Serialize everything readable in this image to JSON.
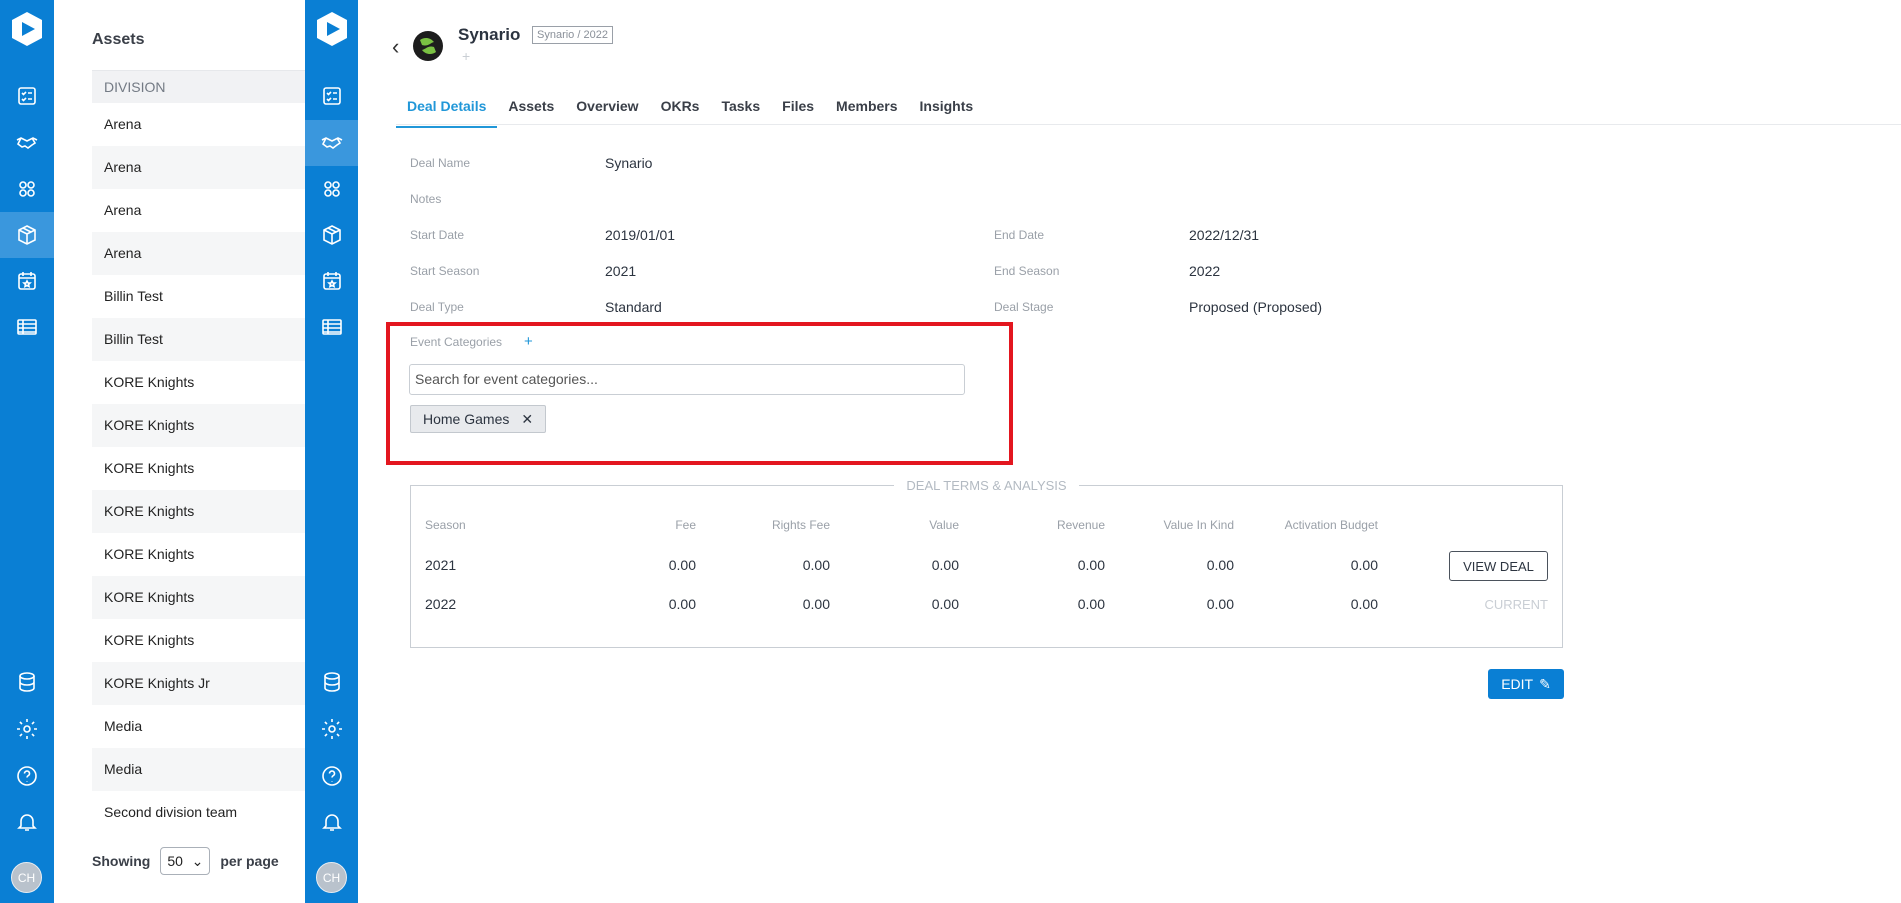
{
  "rail": {
    "avatar_initials": "CH",
    "icons": [
      "checklist-icon",
      "handshake-icon",
      "people-icon",
      "box-icon",
      "calendar-icon",
      "table-icon",
      "database-icon",
      "gear-icon",
      "help-icon",
      "bell-icon"
    ]
  },
  "assets": {
    "title": "Assets",
    "column_header": "DIVISION",
    "rows": [
      "Arena",
      "Arena",
      "Arena",
      "Arena",
      "Billin Test",
      "Billin Test",
      "KORE Knights",
      "KORE Knights",
      "KORE Knights",
      "KORE Knights",
      "KORE Knights",
      "KORE Knights",
      "KORE Knights",
      "KORE Knights Jr",
      "Media",
      "Media",
      "Second division team"
    ],
    "footer_showing": "Showing",
    "per_page_value": "50",
    "footer_per_page": "per page"
  },
  "header": {
    "property_name": "Synario",
    "property_tag": "Synario / 2022",
    "add_symbol": "+"
  },
  "tabs": [
    "Deal Details",
    "Assets",
    "Overview",
    "OKRs",
    "Tasks",
    "Files",
    "Members",
    "Insights"
  ],
  "deal": {
    "deal_name_label": "Deal Name",
    "deal_name": "Synario",
    "notes_label": "Notes",
    "start_date_label": "Start Date",
    "start_date": "2019/01/01",
    "end_date_label": "End Date",
    "end_date": "2022/12/31",
    "start_season_label": "Start Season",
    "start_season": "2021",
    "end_season_label": "End Season",
    "end_season": "2022",
    "deal_type_label": "Deal Type",
    "deal_type": "Standard",
    "deal_stage_label": "Deal Stage",
    "deal_stage": "Proposed (Proposed)"
  },
  "event_categories": {
    "label": "Event Categories",
    "add_symbol": "+",
    "search_placeholder": "Search for event categories...",
    "chips": [
      "Home Games"
    ]
  },
  "terms": {
    "title": "DEAL TERMS & ANALYSIS",
    "columns": [
      "Season",
      "Fee",
      "Rights Fee",
      "Value",
      "Revenue",
      "Value In Kind",
      "Activation Budget"
    ],
    "rows": [
      {
        "season": "2021",
        "fee": "0.00",
        "rights_fee": "0.00",
        "value": "0.00",
        "revenue": "0.00",
        "value_in_kind": "0.00",
        "activation_budget": "0.00",
        "action": "VIEW DEAL"
      },
      {
        "season": "2022",
        "fee": "0.00",
        "rights_fee": "0.00",
        "value": "0.00",
        "revenue": "0.00",
        "value_in_kind": "0.00",
        "activation_budget": "0.00",
        "action": "CURRENT"
      }
    ]
  },
  "edit_label": "EDIT",
  "colors": {
    "brand": "#0a7fd4",
    "tab_active": "#2197d8",
    "highlight": "#e3161f"
  }
}
